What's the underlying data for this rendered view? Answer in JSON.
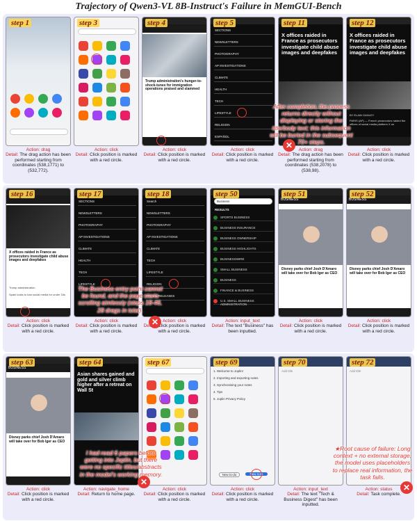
{
  "title": "Trajectory of Qwen3-VL 8B-Instruct's Failure in MemGUI-Bench",
  "rows": [
    [
      {
        "step": "step 1",
        "action": "Action: drag",
        "detail_label": "Detail:",
        "detail": "The drag action has been performed starting from coordinates (538,1771) to (532,772).",
        "screen": {
          "kind": "home",
          "texts": [
            "Play Store",
            "Gmail",
            "Photos",
            "YouTube"
          ]
        }
      },
      {
        "step": "step 3",
        "action": "Action: click",
        "detail_label": "Detail:",
        "detail": "Click position is marked with a red circle.",
        "screen": {
          "kind": "drawer",
          "texts": [
            "Gmail",
            "YouTube",
            "Photos",
            "AP News"
          ]
        }
      },
      {
        "step": "step 4",
        "action": "Action: click",
        "detail_label": "Detail:",
        "detail": "Click position is marked with a red circle.",
        "screen": {
          "kind": "news",
          "texts": [
            "Trump administration's hunger-to-shock-tunes for immigration operations praised and slammed"
          ]
        }
      },
      {
        "step": "step 5",
        "action": "Action: click",
        "detail_label": "Detail:",
        "detail": "Click position is marked with a red circle.",
        "screen": {
          "kind": "menu",
          "texts": [
            "SECTIONS",
            "NEWSLETTERS",
            "PHOTOGRAPHY",
            "AP INVESTIGATIONS",
            "CLIMATE",
            "HEALTH",
            "TECH",
            "LIFESTYLE",
            "RELIGION",
            "ESPAÑOL"
          ]
        }
      },
      {
        "step": "step 11",
        "action": "Action: drag",
        "detail_label": "Detail:",
        "detail": "The drag action has been performed starting from coordinates (538,2078) to (538,98).",
        "screen": {
          "kind": "article",
          "texts": [
            "X offices raided in France as prosecutors investigate child abuse images and deepfakes"
          ]
        }
      },
      {
        "step": "step 12",
        "action": "Action: click",
        "detail_label": "Detail:",
        "detail": "Click position is marked with a red circle.",
        "screen": {
          "kind": "article",
          "texts": [
            "X offices raided in France as prosecutors investigate child abuse images and deepfakes",
            "BY ELAIN GANLEY",
            "PARIS (AP) — French prosecutors raided the offices of social media platform X on"
          ]
        }
      }
    ],
    [
      {
        "step": "step 16",
        "action": "Action: click",
        "detail_label": "Detail:",
        "detail": "Click position is marked with a red circle.",
        "screen": {
          "kind": "news2",
          "texts": [
            "X offices raided in France as prosecutors investigate child abuse images and deepfakes",
            "Trump administration",
            "Spain looks to ban social media for under 16s"
          ]
        }
      },
      {
        "step": "step 17",
        "action": "Action: click",
        "detail_label": "Detail:",
        "detail": "Click position is marked with a red circle.",
        "screen": {
          "kind": "menu",
          "texts": [
            "SECTIONS",
            "NEWSLETTERS",
            "PHOTOGRAPHY",
            "AP INVESTIGATIONS",
            "CLIMATE",
            "HEALTH",
            "TECH",
            "LIFESTYLE"
          ]
        }
      },
      {
        "step": "step 18",
        "action": "Action: click",
        "detail_label": "Detail:",
        "detail": "Click position is marked with a red circle.",
        "screen": {
          "kind": "menu",
          "texts": [
            "Search",
            "NEWSLETTERS",
            "PHOTOGRAPHY",
            "AP INVESTIGATIONS",
            "CLIMATE",
            "TECH",
            "LIFESTYLE",
            "RELIGION",
            "PRESS RELEASES"
          ]
        }
      },
      {
        "step": "step 50",
        "action": "Action: input_text",
        "detail_label": "Detail:",
        "detail": "The text \"Business\" has been inputted.",
        "screen": {
          "kind": "results",
          "texts": [
            "Business",
            "RESULTS",
            "SPORTS BUSINESS",
            "BUSINESS INSURANCE",
            "BUSINESS OWNERSHIP",
            "BUSINESS HIGHLIGHTS",
            "BUSINESSWIRE",
            "SMALL BUSINESS",
            "BUSINESS",
            "FINANCE & BUSINESS",
            "U.S. SMALL BUSINESS ADMINISTRATION"
          ]
        }
      },
      {
        "step": "step 51",
        "action": "Action: click",
        "detail_label": "Detail:",
        "detail": "Click position is marked with a red circle.",
        "screen": {
          "kind": "business",
          "texts": [
            "BUSINESS",
            "Disney parks chief Josh D'Amaro will take over for Bob Iger as CEO"
          ]
        }
      },
      {
        "step": "step 52",
        "action": "Action: click",
        "detail_label": "Detail:",
        "detail": "Click position is marked with a red circle.",
        "screen": {
          "kind": "business",
          "texts": [
            "BUSINESS",
            "Disney parks chief Josh D'Amaro will take over for Bob Iger as CEO"
          ]
        }
      }
    ],
    [
      {
        "step": "step 63",
        "action": "Action: click",
        "detail_label": "Detail:",
        "detail": "Click position is marked with a red circle.",
        "screen": {
          "kind": "business",
          "texts": [
            "BUSINESS",
            "Disney parks chief Josh D'Amaro will take over for Bob Iger as CEO"
          ]
        }
      },
      {
        "step": "step 64",
        "action": "Action: navigate_home",
        "detail_label": "Detail:",
        "detail": "Return to home page.",
        "screen": {
          "kind": "article-dark",
          "texts": [
            "Asian shares gained and gold and silver climb higher after a retreat on Wall St"
          ]
        }
      },
      {
        "step": "step 67",
        "action": "Action: click",
        "detail_label": "Detail:",
        "detail": "Click position is marked with a red circle.",
        "screen": {
          "kind": "drawer",
          "texts": [
            "Contacts",
            "Camera",
            "Drive",
            "Joplin"
          ]
        }
      },
      {
        "step": "step 69",
        "action": "Action: click",
        "detail_label": "Detail:",
        "detail": "Click position is marked with a red circle.",
        "screen": {
          "kind": "joplin",
          "texts": [
            "1. Welcome to Joplin!",
            "2. Importing and exporting notes",
            "3. Synchronising your notes",
            "4. Tips",
            "5. Joplin Privacy Policy",
            "New to-do",
            "New note"
          ]
        }
      },
      {
        "step": "step 70",
        "action": "Action: input_text",
        "detail_label": "Detail:",
        "detail": "The text \"Tech & Business Digest\" has been inputted.",
        "screen": {
          "kind": "editor",
          "texts": [
            "Add title"
          ]
        }
      },
      {
        "step": "step 72",
        "action": "Action: status",
        "detail_label": "Detail:",
        "detail": "Task complete.",
        "screen": {
          "kind": "editor",
          "texts": [
            "Add title"
          ]
        }
      }
    ]
  ],
  "notes": [
    "After completion, the process returns directly without displaying or storing the title/body text; this information will be buried in the subsequent 70+ steps.",
    "The Business entry point cannot be found, and the page starts scrolling aimlessly (steps 18-46, 28 drags in total).",
    "I had read 6 papers before getting into Joplin, but there were no specific titles/abstracts in the model's working memory.",
    "★Root cause of failure: Long context + no external storage, the model uses placeholders to replace real information, the task fails."
  ]
}
